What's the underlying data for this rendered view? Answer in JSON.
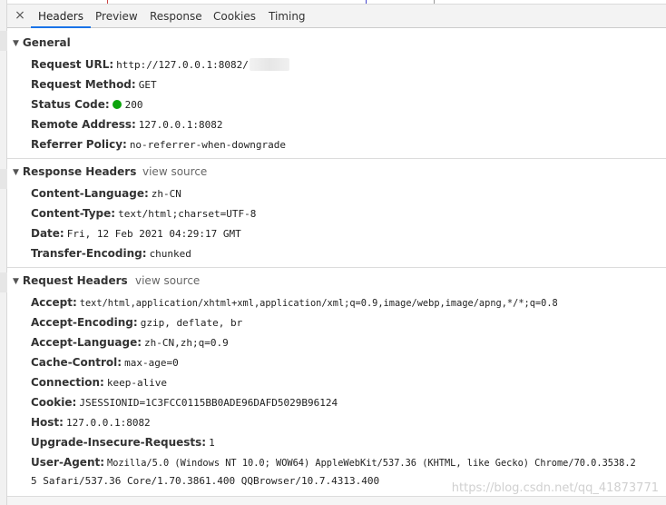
{
  "tabs": {
    "close_glyph": "×",
    "items": [
      "Headers",
      "Preview",
      "Response",
      "Cookies",
      "Timing"
    ],
    "active": "Headers",
    "accent_color": "#1a73e8"
  },
  "general": {
    "title": "General",
    "rows": [
      {
        "key": "Request URL:",
        "value": "http://127.0.0.1:8082/"
      },
      {
        "key": "Request Method:",
        "value": "GET"
      },
      {
        "key": "Status Code:",
        "value": "200"
      },
      {
        "key": "Remote Address:",
        "value": "127.0.0.1:8082"
      },
      {
        "key": "Referrer Policy:",
        "value": "no-referrer-when-downgrade"
      }
    ],
    "status_color": "#0ca40c"
  },
  "response_headers": {
    "title": "Response Headers",
    "view_source": "view source",
    "rows": [
      {
        "key": "Content-Language:",
        "value": "zh-CN"
      },
      {
        "key": "Content-Type:",
        "value": "text/html;charset=UTF-8"
      },
      {
        "key": "Date:",
        "value": "Fri, 12 Feb 2021 04:29:17 GMT"
      },
      {
        "key": "Transfer-Encoding:",
        "value": "chunked"
      }
    ]
  },
  "request_headers": {
    "title": "Request Headers",
    "view_source": "view source",
    "rows": [
      {
        "key": "Accept:",
        "value": "text/html,application/xhtml+xml,application/xml;q=0.9,image/webp,image/apng,*/*;q=0.8"
      },
      {
        "key": "Accept-Encoding:",
        "value": "gzip, deflate, br"
      },
      {
        "key": "Accept-Language:",
        "value": "zh-CN,zh;q=0.9"
      },
      {
        "key": "Cache-Control:",
        "value": "max-age=0"
      },
      {
        "key": "Connection:",
        "value": "keep-alive"
      },
      {
        "key": "Cookie:",
        "value": "JSESSIONID=1C3FCC0115BB0ADE96DAFD5029B96124"
      },
      {
        "key": "Host:",
        "value": "127.0.0.1:8082"
      },
      {
        "key": "Upgrade-Insecure-Requests:",
        "value": "1"
      },
      {
        "key": "User-Agent:",
        "value": "Mozilla/5.0 (Windows NT 10.0; WOW64) AppleWebKit/537.36 (KHTML, like Gecko) Chrome/70.0.3538.2"
      }
    ],
    "user_agent_continuation": "5 Safari/537.36 Core/1.70.3861.400 QQBrowser/10.7.4313.400"
  },
  "watermark": "https://blog.csdn.net/qq_41873771"
}
